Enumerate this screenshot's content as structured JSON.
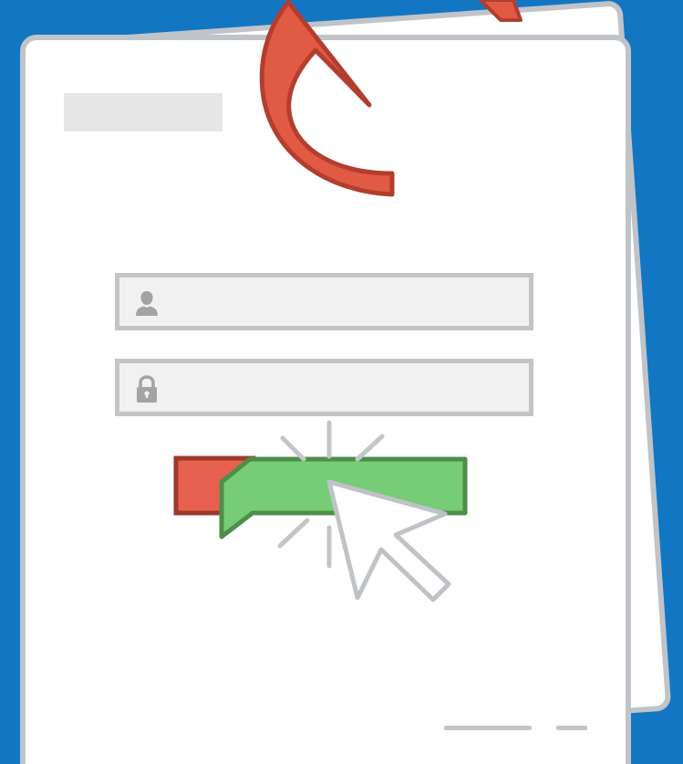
{
  "login_form": {
    "title": "",
    "username_field": {
      "value": "",
      "placeholder": "",
      "icon": "user-icon"
    },
    "password_field": {
      "value": "",
      "placeholder": "",
      "icon": "lock-icon"
    },
    "real_button": {
      "label": "",
      "color": "#e8604f"
    },
    "fake_button": {
      "label": "",
      "color": "#77cc77"
    }
  },
  "decorations": {
    "phishing_hook": {
      "icon": "fishing-hook-icon",
      "color": "#e05a44"
    },
    "cursor": {
      "icon": "mouse-pointer-icon"
    },
    "click_burst": {
      "icon": "click-burst-icon"
    }
  },
  "colors": {
    "background": "#1276c2",
    "card": "#ffffff",
    "card_border": "#c0c4c8"
  }
}
